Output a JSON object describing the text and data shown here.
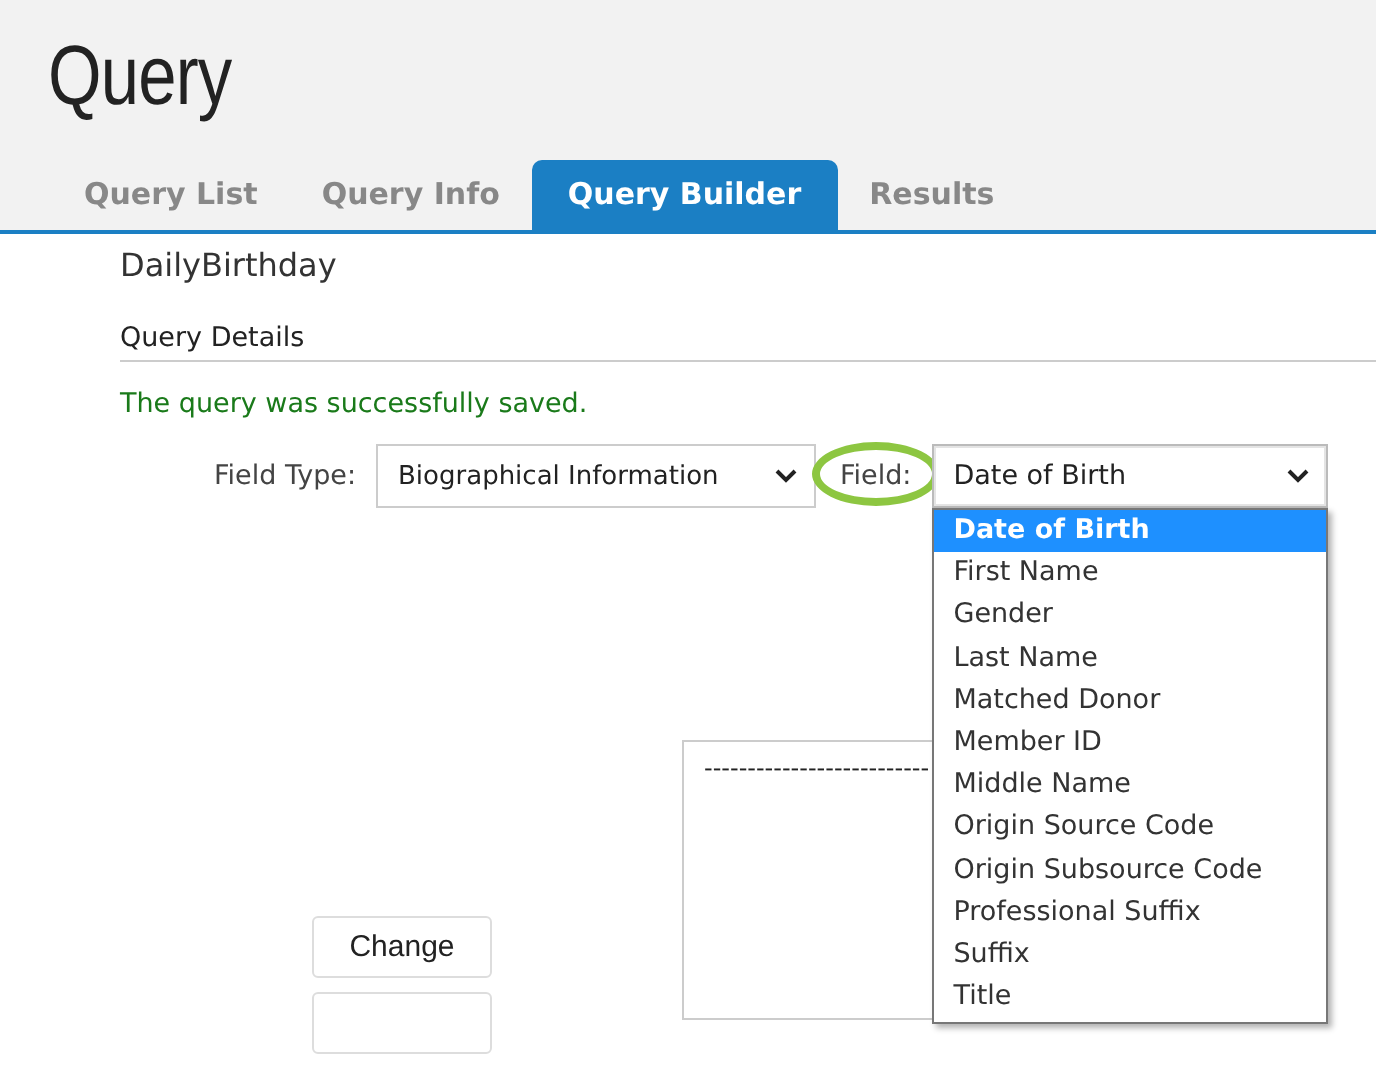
{
  "page": {
    "title": "Query"
  },
  "tabs": [
    {
      "label": "Query List",
      "selected": false
    },
    {
      "label": "Query Info",
      "selected": false
    },
    {
      "label": "Query Builder",
      "selected": true
    },
    {
      "label": "Results",
      "selected": false
    }
  ],
  "query_name": "DailyBirthday",
  "section_title": "Query Details",
  "message": "The query was successfully saved.",
  "selects": [
    {
      "label": "Field Type:",
      "value": "Biographical Information"
    },
    {
      "label": "Field:",
      "value": "Date of Birth",
      "circled": true,
      "expanded": true,
      "options": [
        {
          "label": "Date of Birth",
          "selected": true
        },
        {
          "label": "First Name",
          "selected": false
        },
        {
          "label": "Gender",
          "selected": false
        },
        {
          "label": "Last Name",
          "selected": false
        },
        {
          "label": "Matched Donor",
          "selected": false
        },
        {
          "label": "Member ID",
          "selected": false
        },
        {
          "label": "Middle Name",
          "selected": false
        },
        {
          "label": "Origin Source Code",
          "selected": false
        },
        {
          "label": "Origin Subsource Code",
          "selected": false
        },
        {
          "label": "Professional Suffix",
          "selected": false
        },
        {
          "label": "Suffix",
          "selected": false
        },
        {
          "label": "Title",
          "selected": false
        }
      ]
    }
  ],
  "expression_box": {
    "value": "--------------------------"
  },
  "buttons": [
    "Change"
  ]
}
